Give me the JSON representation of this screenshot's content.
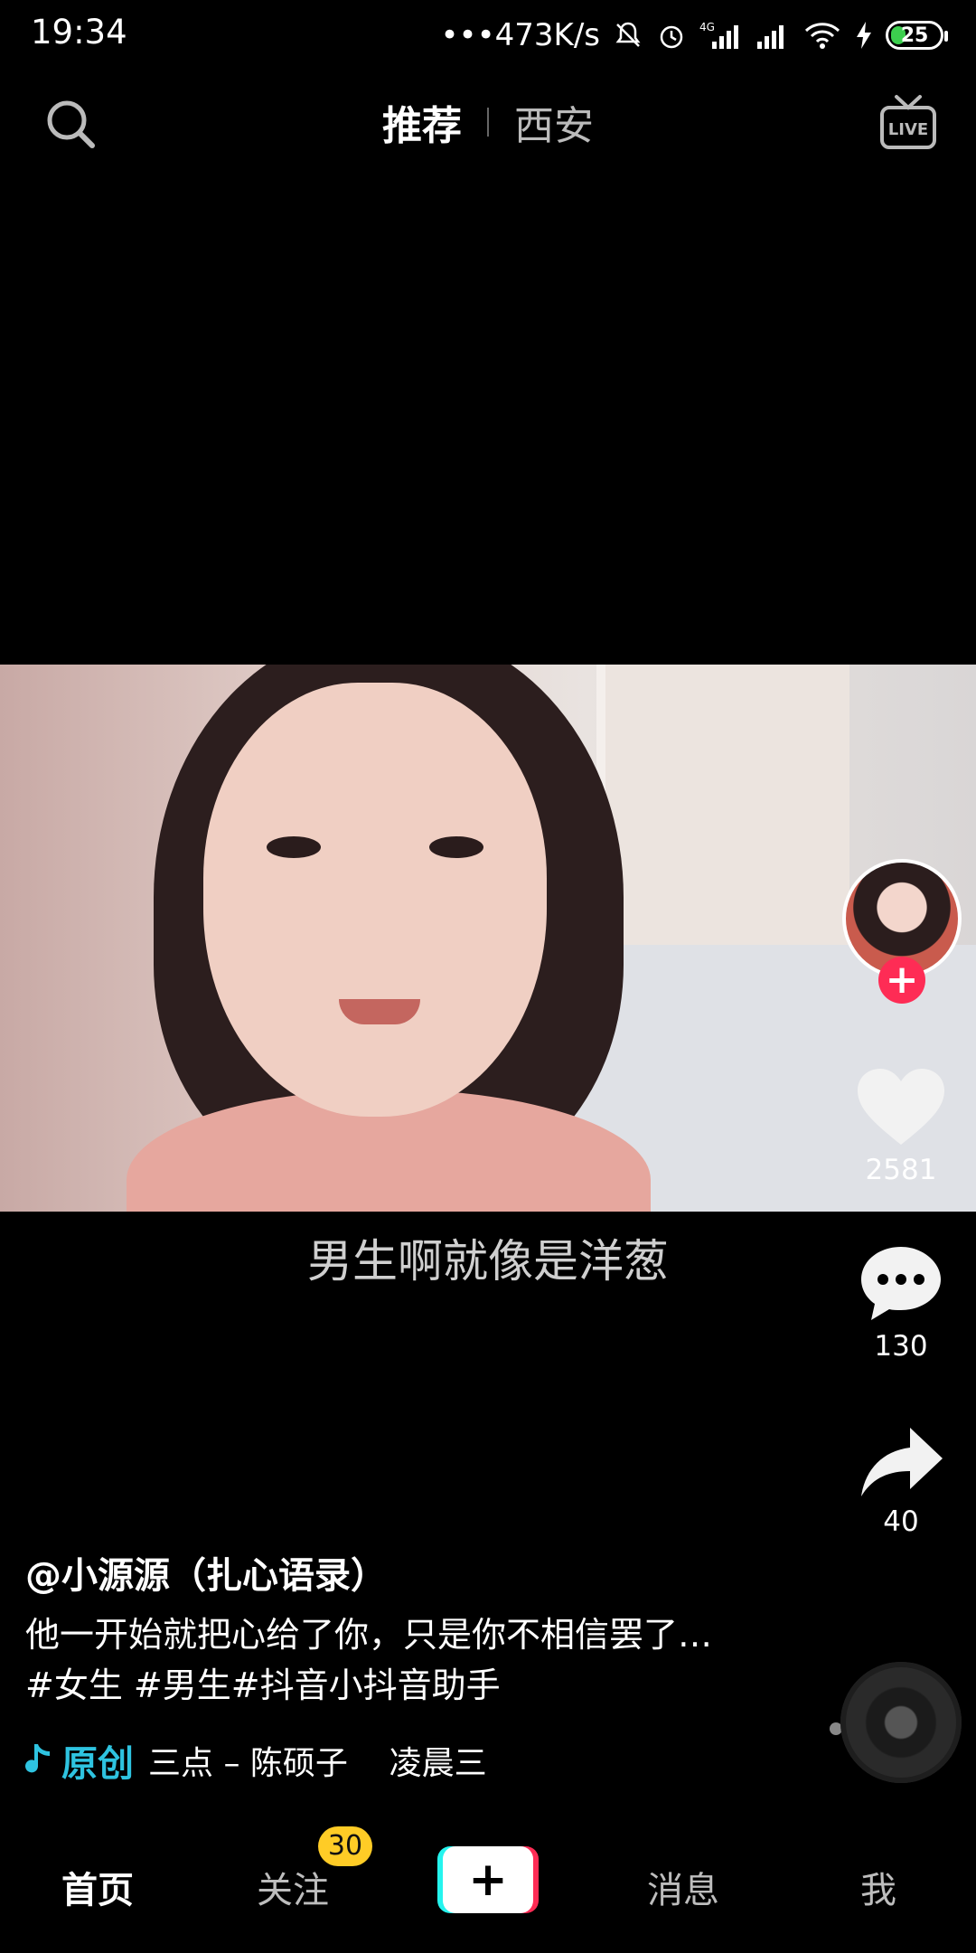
{
  "status_bar": {
    "time": "19:34",
    "net_speed": "•••473K/s",
    "network_label": "4G",
    "battery": "25"
  },
  "top_nav": {
    "tabs": [
      {
        "label": "推荐",
        "active": true
      },
      {
        "label": "西安",
        "active": false
      }
    ],
    "live_icon_label": "LIVE"
  },
  "video": {
    "subtitle": "男生啊就像是洋葱"
  },
  "actions": {
    "likes": "2581",
    "comments": "130",
    "shares": "40",
    "follow_symbol": "+"
  },
  "post": {
    "author": "@小源源（扎心语录）",
    "description": "他一开始就把心给了你，只是你不相信罢了…#女生 #男生#抖音小抖音助手",
    "music_original": "原创",
    "music_text": "三点 – 陈硕子    凌晨三"
  },
  "bottom_tabs": {
    "home": "首页",
    "follow": "关注",
    "follow_badge": "30",
    "add_symbol": "+",
    "messages": "消息",
    "me": "我"
  },
  "colors": {
    "accent_red": "#fe2c55",
    "accent_cyan": "#25f4ee",
    "music_blue": "#2ec3e0",
    "badge_yellow": "#ffcc26"
  }
}
